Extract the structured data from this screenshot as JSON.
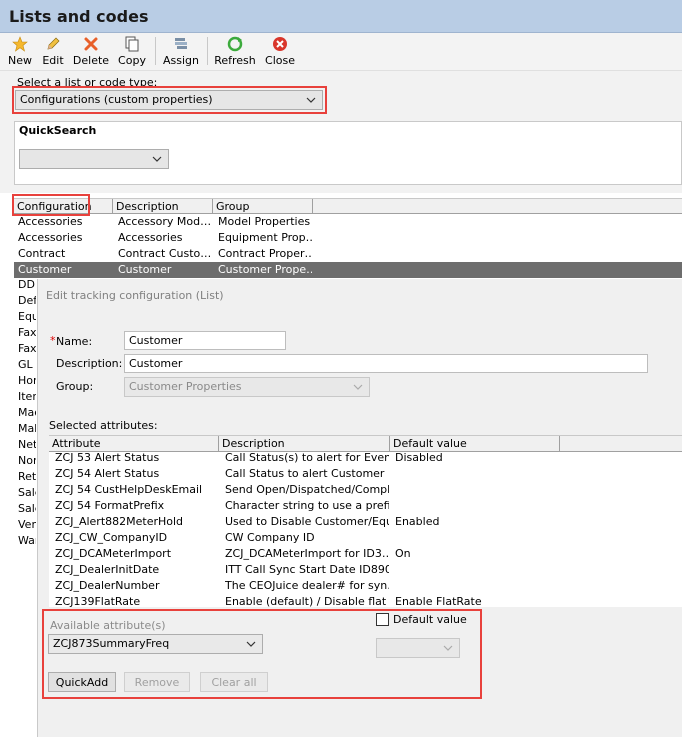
{
  "window": {
    "title": "Lists and codes"
  },
  "toolbar": {
    "new": "New",
    "edit": "Edit",
    "delete": "Delete",
    "copy": "Copy",
    "assign": "Assign",
    "refresh": "Refresh",
    "close": "Close"
  },
  "list_type": {
    "label": "Select a list or code type:",
    "value": "Configurations (custom properties)"
  },
  "quicksearch": {
    "label": "QuickSearch",
    "value": ""
  },
  "grid": {
    "columns": [
      "Configuration",
      "Description",
      "Group"
    ],
    "rows": [
      [
        "Accessories",
        "Accessory Mod…",
        "Model Properties"
      ],
      [
        "Accessories",
        "Accessories",
        "Equipment Prop…"
      ],
      [
        "Contract",
        "Contract Custo…",
        "Contract Proper…"
      ],
      [
        "Customer",
        "Customer",
        "Customer Prope…"
      ]
    ],
    "truncated_rows": [
      "DDD",
      "Defi",
      "Equ",
      "Fax",
      "Fax",
      "GL A",
      "Hom",
      "Item",
      "Mac",
      "Mak",
      "Net",
      "Non",
      "Reti",
      "Sale",
      "Sale",
      "Ven",
      "War"
    ]
  },
  "dialog": {
    "title": "Edit tracking configuration (List)",
    "required_mark": "*",
    "name_label": "Name:",
    "name_value": "Customer",
    "description_label": "Description:",
    "description_value": "Customer",
    "group_label": "Group:",
    "group_value": "Customer Properties",
    "selected_label": "Selected attributes:",
    "attr_columns": [
      "Attribute",
      "Description",
      "Default value"
    ],
    "attr_rows": [
      [
        "ZCJ 53 Alert Status",
        "Call Status(s) to alert for Even…",
        "Disabled"
      ],
      [
        "ZCJ 54 Alert Status",
        "Call Status to alert Customer …",
        ""
      ],
      [
        "ZCJ 54 CustHelpDeskEmail",
        "Send Open/Dispatched/Compl…",
        ""
      ],
      [
        "ZCJ 54 FormatPrefix",
        "Character string to use a prefi…",
        ""
      ],
      [
        "ZCJ_Alert882MeterHold",
        "Used to Disable Customer/Equi…",
        "Enabled"
      ],
      [
        "ZCJ_CW_CompanyID",
        "CW Company ID",
        ""
      ],
      [
        "ZCJ_DCAMeterImport",
        "ZCJ_DCAMeterImport for ID3…",
        "On"
      ],
      [
        "ZCJ_DealerInitDate",
        "ITT Call Sync Start Date ID890",
        ""
      ],
      [
        "ZCJ_DealerNumber",
        "The CEOJuice dealer# for syn…",
        ""
      ],
      [
        "ZCJ139FlatRate",
        "Enable (default) / Disable flat r…",
        "Enable FlatRate"
      ]
    ],
    "available_label": "Available attribute(s)",
    "available_value": "ZCJ873SummaryFreq",
    "default_value_label": "Default value",
    "quickadd": "QuickAdd",
    "remove": "Remove",
    "clear_all": "Clear all"
  },
  "colors": {
    "titlebar": "#b9cde5",
    "selected_row": "#6d6d6d",
    "highlight": "#e8413c"
  }
}
